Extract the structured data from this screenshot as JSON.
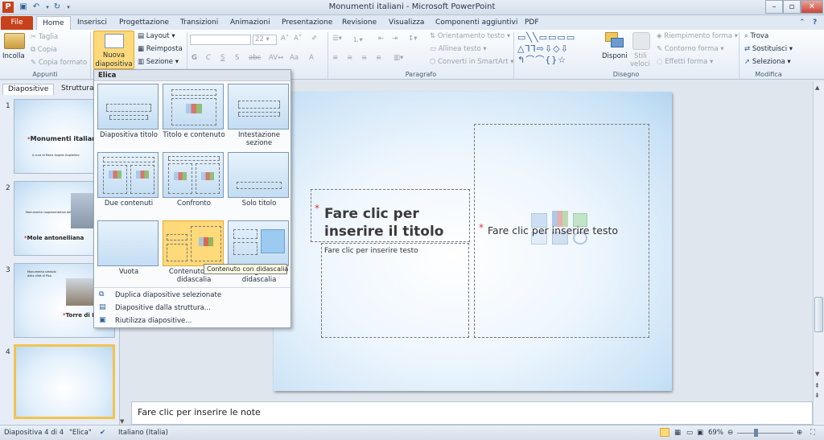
{
  "window": {
    "title": "Monumenti italiani - Microsoft PowerPoint"
  },
  "tabs": [
    "File",
    "Home",
    "Inserisci",
    "Progettazione",
    "Transizioni",
    "Animazioni",
    "Presentazione",
    "Revisione",
    "Visualizza",
    "Componenti aggiuntivi",
    "PDF"
  ],
  "ribbon": {
    "clipboard": {
      "paste": "Incolla",
      "cut": "Taglia",
      "copy": "Copia",
      "format_painter": "Copia formato",
      "group": "Appunti"
    },
    "slides": {
      "new_slide_line1": "Nuova",
      "new_slide_line2": "diapositiva",
      "layout": "Layout",
      "reset": "Reimposta",
      "section": "Sezione"
    },
    "font": {
      "size": "22",
      "bold": "G",
      "italic": "C",
      "underline": "S",
      "strike": "S",
      "spacing": "abc",
      "case": "Aa",
      "color": "A"
    },
    "paragraph": {
      "text_direction": "Orientamento testo",
      "align_text": "Allinea testo",
      "smartart": "Converti in SmartArt",
      "group": "Paragrafo"
    },
    "drawing": {
      "arrange": "Disponi",
      "quick_styles_line1": "Stili",
      "quick_styles_line2": "veloci",
      "shape_fill": "Riempimento forma",
      "shape_outline": "Contorno forma",
      "shape_effects": "Effetti forma",
      "group": "Disegno"
    },
    "editing": {
      "find": "Trova",
      "replace": "Sostituisci",
      "select": "Seleziona",
      "group": "Modifica"
    }
  },
  "left_pane": {
    "tabs": [
      "Diapositive",
      "Struttura"
    ],
    "thumbs": [
      {
        "num": "1",
        "title": "Monumenti italian",
        "subtitle": "A cura di Maria Angela Guglielmo"
      },
      {
        "num": "2",
        "title": "Mole antonelliana",
        "bullet": "Monumento rappresentativo della città"
      },
      {
        "num": "3",
        "title": "Torre di P",
        "bullets": "Monumento simbolo della città di Pisa"
      },
      {
        "num": "4"
      }
    ]
  },
  "slide": {
    "title_placeholder_line1": "Fare clic per",
    "title_placeholder_line2": "inserire il titolo",
    "text_placeholder": "Fare clic per inserire testo",
    "content_placeholder": "Fare clic per inserire testo"
  },
  "layout_menu": {
    "header": "Elica",
    "layouts": [
      {
        "label": "Diapositiva titolo"
      },
      {
        "label": "Titolo e contenuto"
      },
      {
        "label": "Intestazione sezione"
      },
      {
        "label": "Due contenuti"
      },
      {
        "label": "Confronto"
      },
      {
        "label": "Solo titolo"
      },
      {
        "label": "Vuota"
      },
      {
        "label": "Contenuto con didascalia"
      },
      {
        "label": "Immagine con didascalia"
      }
    ],
    "actions": [
      "Duplica diapositive selezionate",
      "Diapositive dalla struttura...",
      "Riutilizza diapositive..."
    ],
    "tooltip": "Contenuto con didascalia"
  },
  "notes": {
    "placeholder": "Fare clic per inserire le note"
  },
  "status": {
    "slide": "Diapositiva 4 di 4",
    "theme": "\"Elica\"",
    "language": "Italiano (Italia)",
    "zoom": "69%"
  },
  "colors": {
    "file_tab": "#c7421b",
    "accent_hover": "#ffd97a",
    "selected_thumb": "#f2c34e"
  }
}
